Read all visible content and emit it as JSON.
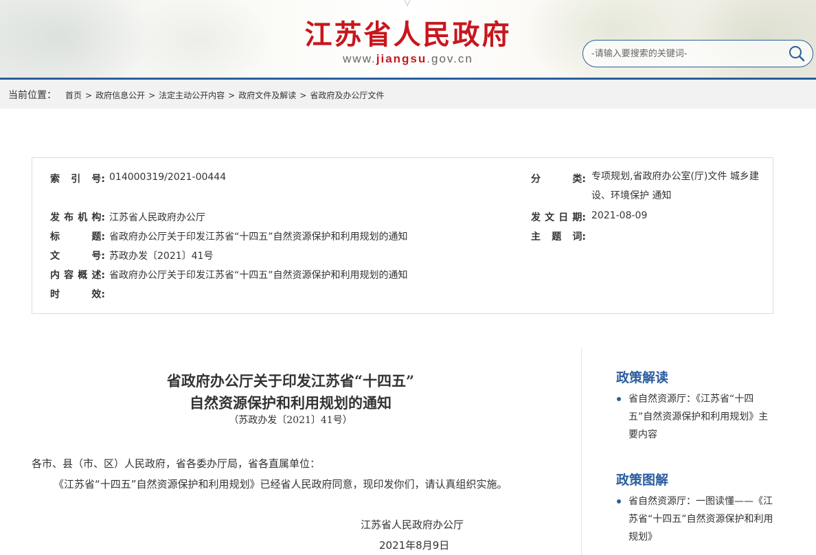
{
  "header": {
    "site_title": "江苏省人民政府",
    "url_prefix": "www.",
    "url_domain": "jiangsu",
    "url_suffix": ".gov.cn",
    "search_placeholder": "-请输入要搜索的关键词-"
  },
  "breadcrumb": {
    "label": "当前位置：",
    "items": [
      "首页",
      "政府信息公开",
      "法定主动公开内容",
      "政府文件及解读",
      "省政府及办公厅文件"
    ],
    "separator": ">"
  },
  "meta": {
    "index_label": "索引号:",
    "index_value": "014000319/2021-00444",
    "category_label": "分类:",
    "category_value_line1": "专项规划,省政府办公室(厅)文件 城乡建",
    "category_value_line2": "设、环境保护 通知",
    "publisher_label": "发布机构:",
    "publisher_value": "江苏省人民政府办公厅",
    "date_label": "发文日期:",
    "date_value": "2021-08-09",
    "title_label": "标题:",
    "title_value": "省政府办公厅关于印发江苏省“十四五”自然资源保护和利用规划的通知",
    "keywords_label": "主题词:",
    "keywords_value": "",
    "docno_label": "文号:",
    "docno_value": "苏政办发〔2021〕41号",
    "summary_label": "内容概述:",
    "summary_value": "省政府办公厅关于印发江苏省“十四五”自然资源保护和利用规划的通知",
    "validity_label": "时效:",
    "validity_value": ""
  },
  "document": {
    "title_line1": "省政府办公厅关于印发江苏省“十四五”",
    "title_line2": "自然资源保护和利用规划的通知",
    "doc_number": "（苏政办发〔2021〕41号）",
    "salutation": "各市、县（市、区）人民政府，省各委办厅局，省各直属单位：",
    "body": "《江苏省“十四五”自然资源保护和利用规划》已经省人民政府同意，现印发你们，请认真组织实施。",
    "signature": "江苏省人民政府办公厅",
    "date": "2021年8月9日"
  },
  "sidebar": {
    "policy_reading_heading": "政策解读",
    "policy_reading_item": "省自然资源厅：《江苏省“十四五”自然资源保护和利用规划》主要内容",
    "policy_graphic_heading": "政策图解",
    "policy_graphic_item": "省自然资源厅：一图读懂——《江苏省“十四五”自然资源保护和利用规划》"
  },
  "colors": {
    "brand_red": "#c8161d",
    "brand_blue": "#2a5d9e"
  }
}
